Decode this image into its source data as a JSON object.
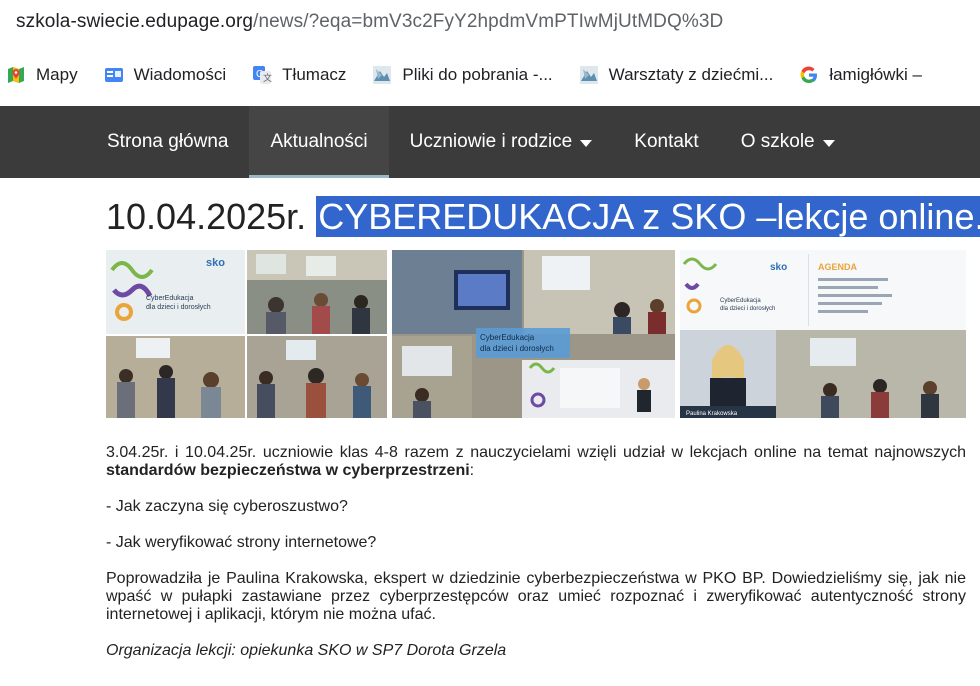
{
  "browser": {
    "url_host": "szkola-swiecie.edupage.org",
    "url_path": "/news/?eqa=bmV3c2FyY2hpdmVmPTIwMjUtMDQ%3D"
  },
  "bookmarks": [
    {
      "label": "Mapy",
      "icon": "maps-icon"
    },
    {
      "label": "Wiadomości",
      "icon": "news-icon"
    },
    {
      "label": "Tłumacz",
      "icon": "translate-icon"
    },
    {
      "label": "Pliki do pobrania -...",
      "icon": "site-icon"
    },
    {
      "label": "Warsztaty z dziećmi...",
      "icon": "site-icon"
    },
    {
      "label": "łamigłówki –",
      "icon": "google-icon"
    }
  ],
  "nav": {
    "items": [
      {
        "label": "Strona główna"
      },
      {
        "label": "Aktualności"
      },
      {
        "label": "Uczniowie i rodzice"
      },
      {
        "label": "Kontakt"
      },
      {
        "label": "O szkole"
      }
    ]
  },
  "article": {
    "date": "10.04.2025r.",
    "title_highlight": "CYBEREDUKACJA z SKO –lekcje online.",
    "p1_start": "3.04.25r. i 10.04.25r. uczniowie klas 4-8 razem z  nauczycielami  wzięli udział w lekcjach online na temat najnowszych ",
    "p1_bold": "standardów bezpieczeństwa w cyberprzestrzeni",
    "p1_end": ":",
    "q1": "- Jak zaczyna się cyberoszustwo?",
    "q2": "- Jak weryfikować strony internetowe?",
    "p2": "Poprowadziła je  Paulina Krakowska, ekspert w dziedzinie cyberbezpieczeństwa w PKO BP. Dowiedzieliśmy się, jak nie wpaść w pułapki zastawiane przez cyberprzestępców oraz  umieć rozpoznać i zweryfikować autentyczność strony internetowej i aplikacji, którym nie można ufać.",
    "footer": "Organizacja lekcji: opiekunka SKO w SP7 Dorota Grzela"
  },
  "photos": [
    {
      "slide_logo": "sko",
      "slide_title": "CyberEdukacja",
      "slide_subtitle": "dla dzieci i dorosłych"
    },
    {
      "slide_title": "CyberEdukacja",
      "slide_subtitle": "dla dzieci i dorosłych"
    },
    {
      "slide_logo": "sko",
      "agenda_label": "AGENDA",
      "slide_title": "CyberEdukacja",
      "slide_subtitle": "dla dzieci i dorosłych",
      "caption": "Paulina Krakowska"
    }
  ],
  "colors": {
    "nav_bg": "#3b3b3b",
    "highlight": "#3366cc"
  }
}
